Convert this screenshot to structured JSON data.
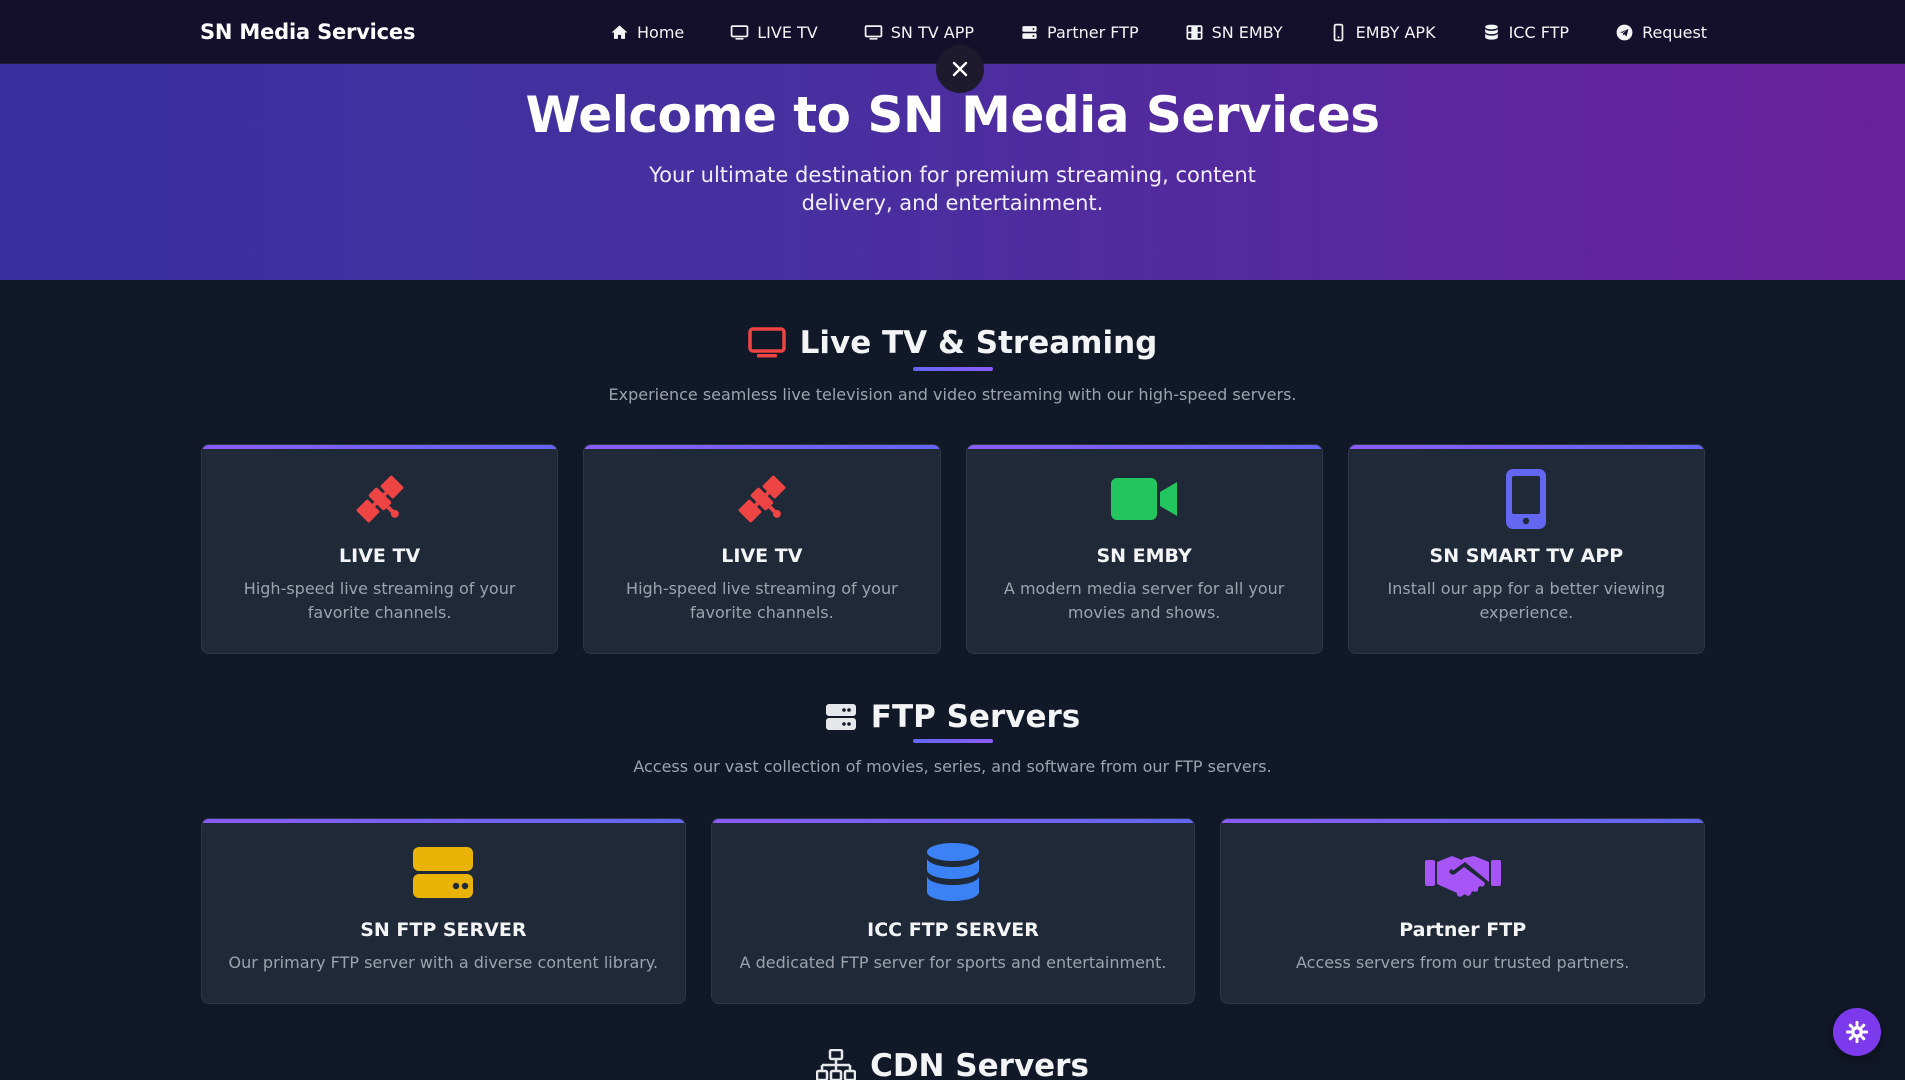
{
  "navbar": {
    "brand": "SN Media Services",
    "links": [
      {
        "label": "Home",
        "icon": "home-icon"
      },
      {
        "label": "LIVE TV",
        "icon": "monitor-icon"
      },
      {
        "label": "SN TV APP",
        "icon": "monitor-icon"
      },
      {
        "label": "Partner FTP",
        "icon": "server-icon"
      },
      {
        "label": "SN EMBY",
        "icon": "film-icon"
      },
      {
        "label": "EMBY APK",
        "icon": "mobile-icon"
      },
      {
        "label": "ICC FTP",
        "icon": "database-icon"
      },
      {
        "label": "Request",
        "icon": "telegram-icon"
      }
    ]
  },
  "hero": {
    "title": "Welcome to SN Media Services",
    "subtitle": "Your ultimate destination for premium streaming, content delivery, and entertainment."
  },
  "sections": {
    "live": {
      "title": "Live TV & Streaming",
      "description": "Experience seamless live television and video streaming with our high-speed servers.",
      "icon_color": "#ef4444",
      "cards": [
        {
          "title": "LIVE TV",
          "desc": "High-speed live streaming of your favorite channels.",
          "icon": "satellite-icon",
          "color": "#ef4444"
        },
        {
          "title": "LIVE TV",
          "desc": "High-speed live streaming of your favorite channels.",
          "icon": "satellite-icon",
          "color": "#ef4444"
        },
        {
          "title": "SN EMBY",
          "desc": "A modern media server for all your movies and shows.",
          "icon": "video-camera-icon",
          "color": "#22c55e"
        },
        {
          "title": "SN SMART TV APP",
          "desc": "Install our app for a better viewing experience.",
          "icon": "mobile-icon",
          "color": "#6366f1"
        }
      ]
    },
    "ftp": {
      "title": "FTP Servers",
      "description": "Access our vast collection of movies, series, and software from our FTP servers.",
      "cards": [
        {
          "title": "SN FTP SERVER",
          "desc": "Our primary FTP server with a diverse content library.",
          "icon": "hdd-icon",
          "color": "#eab308"
        },
        {
          "title": "ICC FTP SERVER",
          "desc": "A dedicated FTP server for sports and entertainment.",
          "icon": "database-icon",
          "color": "#3b82f6"
        },
        {
          "title": "Partner FTP",
          "desc": "Access servers from our trusted partners.",
          "icon": "handshake-icon",
          "color": "#a855f7"
        }
      ]
    },
    "cdn": {
      "title": "CDN Servers"
    }
  },
  "colors": {
    "accent": "#7c3aed",
    "navbar_bg": "#140f2a",
    "page_bg": "#111827",
    "card_bg": "#1f2937"
  }
}
